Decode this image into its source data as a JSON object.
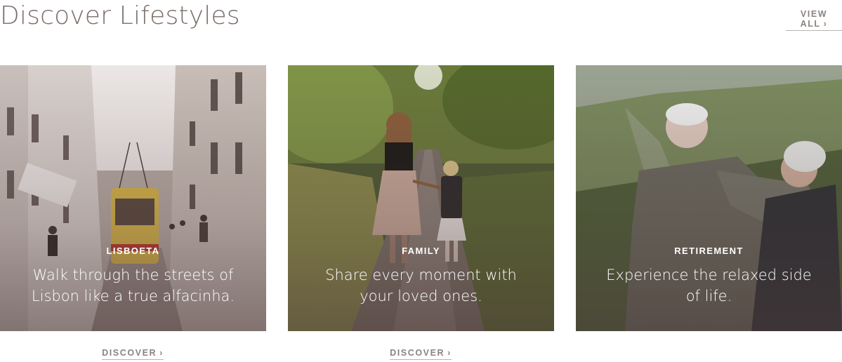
{
  "section": {
    "title": "Discover Lifestyles",
    "view_all_label": "VIEW ALL",
    "chevron_glyph": "›"
  },
  "cards": [
    {
      "tag": "LISBOETA",
      "caption": "Walk through the streets of Lisbon like a true alfacinha.",
      "discover_label": "DISCOVER",
      "image_icon": "lisbon-street-tram-photo"
    },
    {
      "tag": "FAMILY",
      "caption": "Share every moment with your loved ones.",
      "discover_label": "DISCOVER",
      "image_icon": "mother-daughter-path-photo"
    },
    {
      "tag": "RETIREMENT",
      "caption": "Experience the relaxed side of life.",
      "image_icon": "elderly-couple-hillside-photo"
    }
  ],
  "colors": {
    "title": "#7a6e69",
    "link": "#8b8480",
    "overlay": "#483636"
  }
}
